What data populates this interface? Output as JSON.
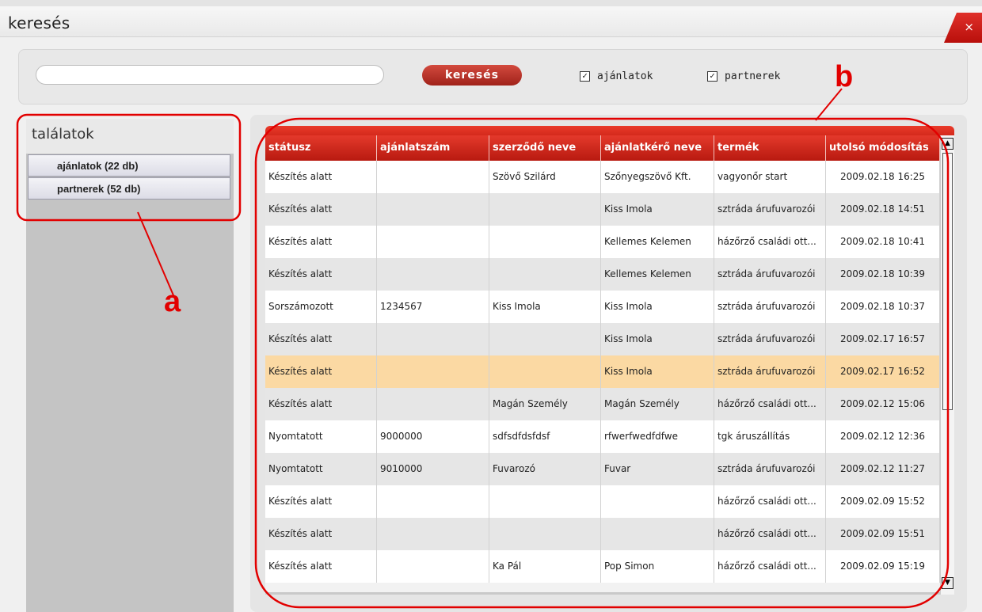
{
  "window": {
    "title": "keresés",
    "close_glyph": "×"
  },
  "search": {
    "input_value": "",
    "button_label": "keresés",
    "checkboxes": [
      {
        "label": "ajánlatok",
        "checked": true,
        "glyph": "✓"
      },
      {
        "label": "partnerek",
        "checked": true,
        "glyph": "✓"
      }
    ]
  },
  "results": {
    "title": "találatok",
    "items": [
      "ajánlatok (22 db)",
      "partnerek (52 db)"
    ]
  },
  "table": {
    "columns": [
      "státusz",
      "ajánlatszám",
      "szerződő neve",
      "ajánlatkérő neve",
      "termék",
      "utolsó módosítás"
    ],
    "selected_row": 6,
    "rows": [
      [
        "Készítés alatt",
        "",
        "Szövő Szilárd",
        "Szőnyegszövő Kft.",
        "vagyonőr start",
        "2009.02.18 16:25"
      ],
      [
        "Készítés alatt",
        "",
        "",
        "Kiss Imola",
        "sztráda árufuvarozói",
        "2009.02.18 14:51"
      ],
      [
        "Készítés alatt",
        "",
        "",
        "Kellemes Kelemen",
        "házőrző családi ott...",
        "2009.02.18 10:41"
      ],
      [
        "Készítés alatt",
        "",
        "",
        "Kellemes Kelemen",
        "sztráda árufuvarozói",
        "2009.02.18 10:39"
      ],
      [
        "Sorszámozott",
        "1234567",
        "Kiss Imola",
        "Kiss Imola",
        "sztráda árufuvarozói",
        "2009.02.18 10:37"
      ],
      [
        "Készítés alatt",
        "",
        "",
        "Kiss Imola",
        "sztráda árufuvarozói",
        "2009.02.17 16:57"
      ],
      [
        "Készítés alatt",
        "",
        "",
        "Kiss Imola",
        "sztráda árufuvarozói",
        "2009.02.17 16:52"
      ],
      [
        "Készítés alatt",
        "",
        "Magán Személy",
        "Magán Személy",
        "házőrző családi ott...",
        "2009.02.12 15:06"
      ],
      [
        "Nyomtatott",
        "9000000",
        "sdfsdfdsfdsf",
        "rfwerfwedfdfwe",
        "tgk áruszállítás",
        "2009.02.12 12:36"
      ],
      [
        "Nyomtatott",
        "9010000",
        "Fuvarozó",
        "Fuvar",
        "sztráda árufuvarozói",
        "2009.02.12 11:27"
      ],
      [
        "Készítés alatt",
        "",
        "",
        "",
        "házőrző családi ott...",
        "2009.02.09 15:52"
      ],
      [
        "Készítés alatt",
        "",
        "",
        "",
        "házőrző családi ott...",
        "2009.02.09 15:51"
      ],
      [
        "Készítés alatt",
        "",
        "Ka Pál",
        "Pop Simon",
        "házőrző családi ott...",
        "2009.02.09 15:19"
      ]
    ],
    "scroll_up_glyph": "▲",
    "scroll_down_glyph": "▼"
  },
  "annotations": {
    "a": "a",
    "b": "b",
    "color": "#e20000"
  }
}
